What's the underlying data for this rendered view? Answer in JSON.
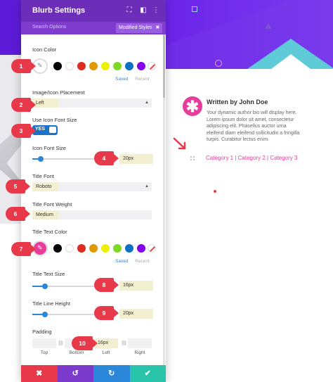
{
  "panel": {
    "title": "Blurb Settings",
    "search_placeholder": "Search Options",
    "modified_label": "Modified Styles",
    "modified_close": "✖"
  },
  "fields": {
    "icon_color": "Icon Color",
    "image_icon_placement": "Image/Icon Placement",
    "image_icon_placement_value": "Left",
    "use_icon_font_size": "Use Icon Font Size",
    "use_icon_font_size_value": "YES",
    "icon_font_size": "Icon Font Size",
    "icon_font_size_value": "20px",
    "title_font": "Title Font",
    "title_font_value": "Roboto",
    "title_font_weight": "Title Font Weight",
    "title_font_weight_value": "Medium",
    "title_text_color": "Title Text Color",
    "title_text_size": "Title Text Size",
    "title_text_size_value": "16px",
    "title_line_height": "Title Line Height",
    "title_line_height_value": "20px",
    "padding": "Padding",
    "padding_left_value": "16px",
    "padding_labels": [
      "Top",
      "Bottom",
      "Left",
      "Right"
    ]
  },
  "palette": {
    "saved": "Saved",
    "recent": "Recent",
    "colors": [
      "#000000",
      "#ffffff",
      "#e02b20",
      "#e09900",
      "#edf000",
      "#7cda24",
      "#0c71c3",
      "#8300e9"
    ],
    "icon_color_selected": "#ffffff",
    "title_color_selected": "#e63d9d"
  },
  "footer": {
    "buttons": [
      {
        "label": "✖",
        "color": "#e8394a"
      },
      {
        "label": "↺",
        "color": "#7c3acd"
      },
      {
        "label": "↻",
        "color": "#2b87da"
      },
      {
        "label": "✔",
        "color": "#29c4a9"
      }
    ]
  },
  "author": {
    "title": "Written by John Doe",
    "bio": "Your dynamic author bio will display here. Lorem ipsum dolor sit amet, consectetur adipiscing elit. Phasellus auctor urna eleifend diam eleifend sollicitudin a fringilla turpis. Curabitur lectus enim.",
    "categories": "Category 1 | Category 2 | Category 3",
    "icon_glyph": "✱"
  },
  "markers": [
    "1",
    "2",
    "3",
    "4",
    "5",
    "6",
    "7",
    "8",
    "9",
    "10"
  ],
  "colors": {
    "header": "#6c2eb9",
    "accent": "#2b87da",
    "marker": "#e8394a",
    "author_pink": "#e63d9d"
  },
  "slider_levels": {
    "icon_font_size": 0.1,
    "title_text_size": 0.15,
    "title_line_height": 0.15
  }
}
